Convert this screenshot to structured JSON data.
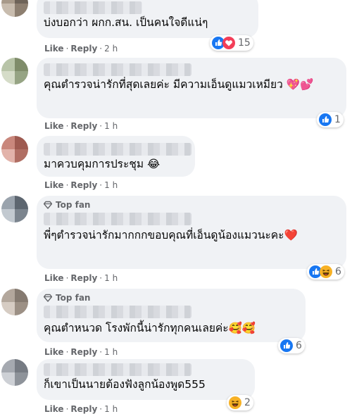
{
  "comments": [
    {
      "top_fan": false,
      "text": "บ่งบอกว่า ผกก.สน. เป็นคนใจดีแน่ๆ",
      "like": "Like",
      "reply": "Reply",
      "time": "2 h",
      "reaction_icons": [
        "like-icon",
        "love-icon"
      ],
      "reaction_count": "15",
      "avatar_colors": [
        "#a89a8a",
        "#6e6358",
        "#c8bcae",
        "#8d7f70"
      ]
    },
    {
      "top_fan": false,
      "text": "คุณตำรวจน่ารักที่สุดเลยค่ะ มีความเอ็นดูแมวเหมียว 💖💕",
      "like": "Like",
      "reply": "Reply",
      "time": "1 h",
      "reaction_icons": [
        "like-icon"
      ],
      "reaction_count": "1",
      "avatar_colors": [
        "#b8c4a8",
        "#7f8c6a",
        "#d5dcc8",
        "#96a484"
      ]
    },
    {
      "top_fan": false,
      "text": "มาควบคุมการประชุม 😂",
      "like": "Like",
      "reply": "Reply",
      "time": "1 h",
      "reaction_icons": [],
      "reaction_count": "",
      "avatar_colors": [
        "#c9877c",
        "#9e5a50",
        "#e2b3aa",
        "#b06e63"
      ]
    },
    {
      "top_fan": true,
      "top_fan_label": "Top fan",
      "text": "พี่ๆตำรวจน่ารักมากกกขอบคุณที่เอ็นดูน้องแมวนะคะ❤️",
      "like": "Like",
      "reply": "Reply",
      "time": "1 h",
      "reaction_icons": [
        "like-icon",
        "haha-icon"
      ],
      "reaction_count": "6",
      "avatar_colors": [
        "#9aa3ad",
        "#5d6670",
        "#c2c9d0",
        "#7b848e"
      ]
    },
    {
      "top_fan": true,
      "top_fan_label": "Top fan",
      "text": "คุณตำหนวด โรงพักนี้น่ารักทุกคนเลยค่ะ🥰🥰",
      "like": "Like",
      "reply": "Reply",
      "time": "1 h",
      "reaction_icons": [
        "like-icon"
      ],
      "reaction_count": "6",
      "avatar_colors": [
        "#b3a79c",
        "#857a70",
        "#d6ccc3",
        "#9c9085"
      ]
    },
    {
      "top_fan": false,
      "text": "ก็เขาเป็นนายต้องฟังลูกน้องพูด555",
      "like": "Like",
      "reply": "Reply",
      "time": "1 h",
      "reaction_icons": [
        "haha-icon"
      ],
      "reaction_count": "2",
      "avatar_colors": [
        "#a5a9b0",
        "#767b83",
        "#cdd0d5",
        "#8e939a"
      ]
    }
  ],
  "colors": {
    "like": "#1877f2",
    "love": "#f33e58",
    "haha": "#f7b125",
    "meta": "#65676b",
    "bubble": "#f0f2f5"
  }
}
